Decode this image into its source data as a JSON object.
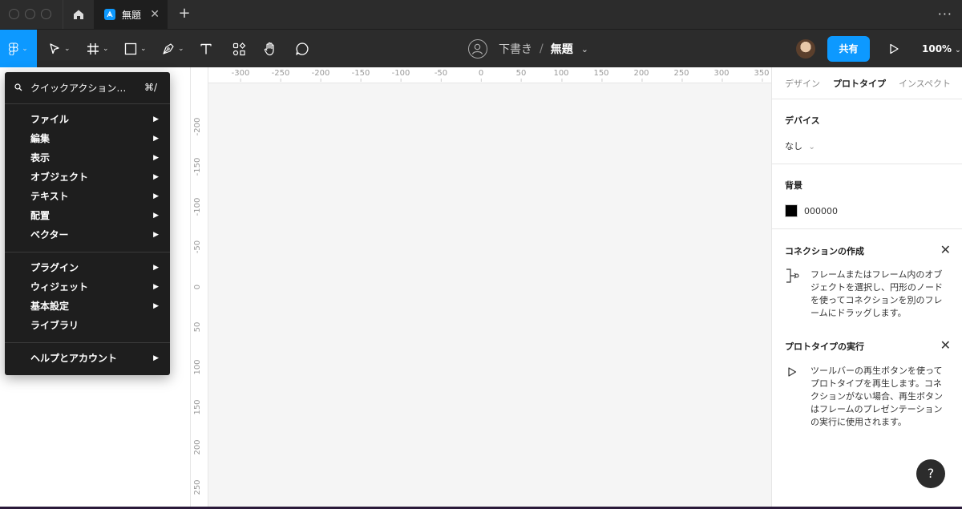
{
  "titlebar": {
    "tab_title": "無題",
    "close_glyph": "✕",
    "new_tab_glyph": "+",
    "more_glyph": "···"
  },
  "toolbar": {
    "draft_label": "下書き",
    "separator": "/",
    "file_name": "無題",
    "share_label": "共有",
    "zoom_label": "100%"
  },
  "main_menu": {
    "search_label": "クイックアクション…",
    "search_shortcut": "⌘/",
    "group1": [
      "ファイル",
      "編集",
      "表示",
      "オブジェクト",
      "テキスト",
      "配置",
      "ベクター"
    ],
    "group2": [
      "プラグイン",
      "ウィジェット",
      "基本設定",
      "ライブラリ"
    ],
    "group3": [
      "ヘルプとアカウント"
    ],
    "submenu_arrow": "▶"
  },
  "rulers": {
    "horizontal": [
      "-300",
      "-250",
      "-200",
      "-150",
      "-100",
      "-50",
      "0",
      "50",
      "100",
      "150",
      "200",
      "250",
      "300",
      "350"
    ],
    "vertical": [
      "-200",
      "-150",
      "-100",
      "-50",
      "0",
      "50",
      "100",
      "150",
      "200",
      "250"
    ]
  },
  "right_panel": {
    "tabs": [
      "デザイン",
      "プロトタイプ",
      "インスペクト"
    ],
    "active_tab": "プロトタイプ",
    "device_title": "デバイス",
    "device_value": "なし",
    "background_title": "背景",
    "background_hex": "000000",
    "background_color": "#000000",
    "connection_title": "コネクションの作成",
    "connection_desc": "フレームまたはフレーム内のオブジェクトを選択し、円形のノードを使ってコネクションを別のフレームにドラッグします。",
    "run_title": "プロトタイプの実行",
    "run_desc": "ツールバーの再生ボタンを使ってプロトタイプを再生します。コネクションがない場合、再生ボタンはフレームのプレゼンテーションの実行に使用されます。",
    "close_glyph": "✕"
  },
  "help_button": "?",
  "colors": {
    "accent": "#0d99ff",
    "chrome": "#2c2c2c",
    "menu_bg": "#1e1e1e",
    "canvas_bg": "#f5f5f5"
  }
}
